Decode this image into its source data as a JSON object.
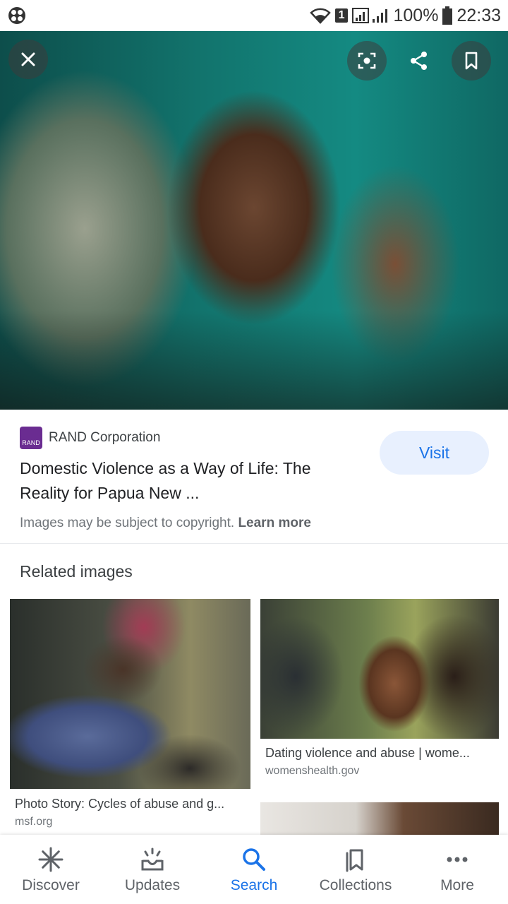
{
  "status_bar": {
    "sim_number": "1",
    "battery": "100%",
    "time": "22:33"
  },
  "source": {
    "favicon_text": "RAND",
    "name": "RAND Corporation",
    "title": "Domestic Violence as a Way of Life: The Reality for Papua New ...",
    "visit_label": "Visit",
    "copyright_text": "Images may be subject to copyright.",
    "learn_more": "Learn more"
  },
  "related": {
    "heading": "Related images",
    "items": [
      {
        "title": "Photo Story: Cycles of abuse and g...",
        "site": "msf.org"
      },
      {
        "title": "Dating violence and abuse | wome...",
        "site": "womenshealth.gov"
      }
    ]
  },
  "nav": {
    "items": [
      {
        "label": "Discover",
        "icon": "asterisk-icon"
      },
      {
        "label": "Updates",
        "icon": "inbox-sparkle-icon"
      },
      {
        "label": "Search",
        "icon": "search-icon"
      },
      {
        "label": "Collections",
        "icon": "collections-icon"
      },
      {
        "label": "More",
        "icon": "more-dots-icon"
      }
    ],
    "active": "Search"
  },
  "colors": {
    "accent": "#1a73e8",
    "visit_bg": "#e8f0fe",
    "favicon_bg": "#6a2c91"
  }
}
